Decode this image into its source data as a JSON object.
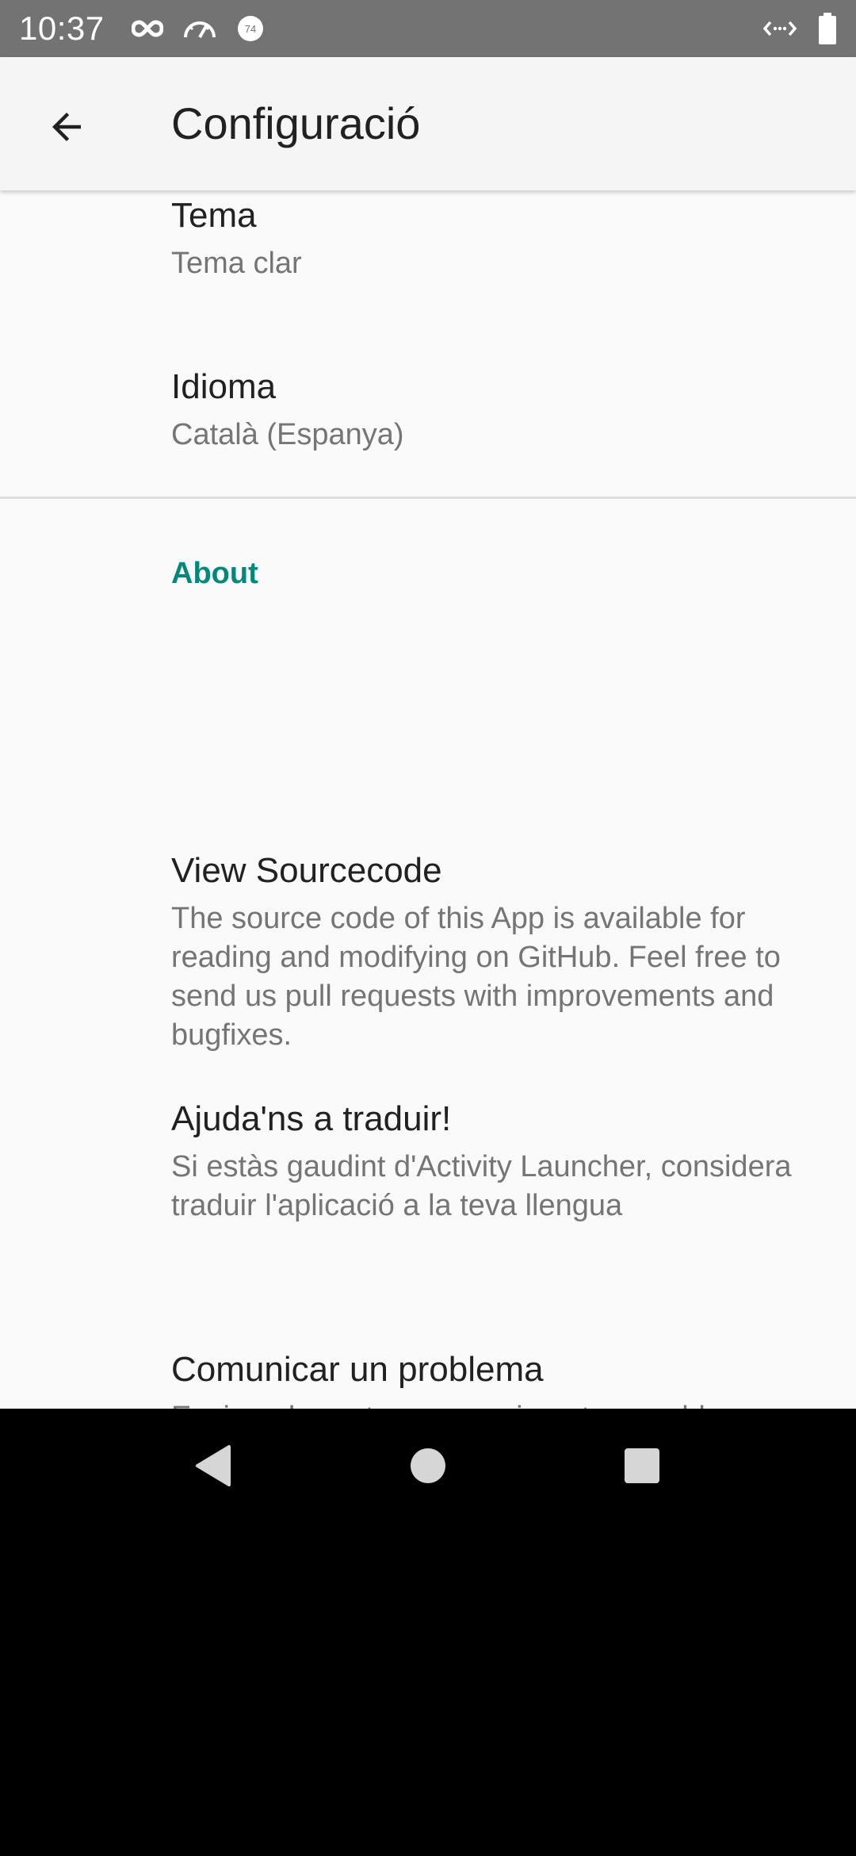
{
  "status_bar": {
    "time": "10:37",
    "left_icons": [
      "infinity-icon",
      "speedometer-icon",
      "notification-badge-icon"
    ],
    "badge_number": "74",
    "right_icons": [
      "code-arrows-icon",
      "battery-icon"
    ]
  },
  "app_bar": {
    "title": "Configuració",
    "back_icon": "arrow-back-icon"
  },
  "preferences": {
    "theme": {
      "title": "Tema",
      "summary": "Tema clar"
    },
    "language": {
      "title": "Idioma",
      "summary": "Català (Espanya)"
    }
  },
  "about": {
    "category": "About",
    "items": [
      {
        "title": "View Sourcecode",
        "summary": "The source code of this App is available for reading and modifying on GitHub. Feel free to send us pull requests with improvements and bugfixes."
      },
      {
        "title": "Ajuda'ns a traduir!",
        "summary": "Si estàs gaudint d'Activity Launcher, considera traduir l'aplicació a la teva llengua"
      },
      {
        "title": "Comunicar un problema",
        "summary": "Envieu els vostres suggeriments o problemes a la nostra pàgina del projecte GitHub."
      }
    ]
  },
  "nav_bar": {
    "buttons": [
      "back-triangle-icon",
      "home-circle-icon",
      "recents-square-icon"
    ]
  },
  "colors": {
    "accent": "#00897b",
    "status_bar": "#737373",
    "app_bar": "#f5f5f5",
    "background": "#fafafa"
  }
}
